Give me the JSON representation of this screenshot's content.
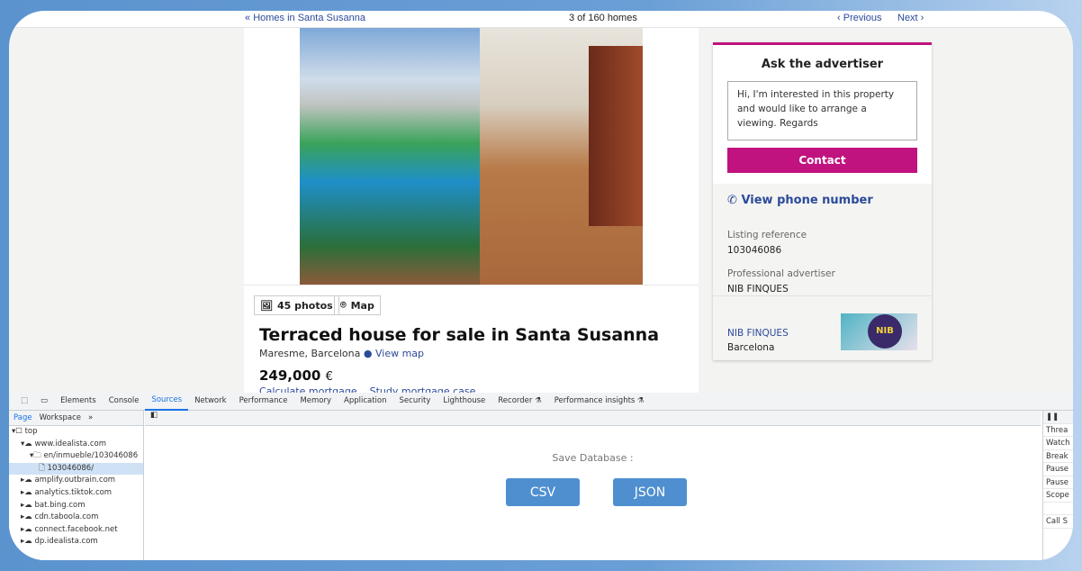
{
  "topnav": {
    "back": "Homes in Santa Susanna",
    "count": "3 of 160 homes",
    "previous": "Previous",
    "next": "Next"
  },
  "listing": {
    "photos": "45 photos",
    "map": "Map",
    "title": "Terraced house for sale in Santa Susanna",
    "location": "Maresme, Barcelona",
    "view_map": "View map",
    "price": "249,000",
    "currency": "€",
    "calc": "Calculate mortgage",
    "study": "Study mortgage case"
  },
  "contact": {
    "heading": "Ask the advertiser",
    "message": "Hi, I'm interested in this property and would like to arrange a viewing. Regards",
    "button": "Contact",
    "phone": "View phone number",
    "ref_label": "Listing reference",
    "ref": "103046086",
    "adv_label": "Professional advertiser",
    "adv": "NIB FINQUES",
    "agency": "NIB FINQUES",
    "city": "Barcelona",
    "logo_text": "NIB"
  },
  "devtools": {
    "tabs": [
      "Elements",
      "Console",
      "Sources",
      "Network",
      "Performance",
      "Memory",
      "Application",
      "Security",
      "Lighthouse",
      "Recorder ⚗",
      "Performance insights ⚗"
    ],
    "subtabs": [
      "Page",
      "Workspace",
      "»"
    ],
    "tree": [
      "top",
      "www.idealista.com",
      "en/inmueble/103046086",
      "103046086/",
      "amplify.outbrain.com",
      "analytics.tiktok.com",
      "bat.bing.com",
      "cdn.taboola.com",
      "connect.facebook.net",
      "dp.idealista.com"
    ],
    "right": [
      "Threa",
      "Watch",
      "Break",
      "Pause",
      "Pause",
      "Scope",
      "",
      "Call S"
    ],
    "save_label": "Save Database :",
    "csv": "CSV",
    "json": "JSON"
  },
  "colors": {
    "accent": "#c0137f",
    "link": "#2c4a9a",
    "button": "#4f8fd0"
  }
}
